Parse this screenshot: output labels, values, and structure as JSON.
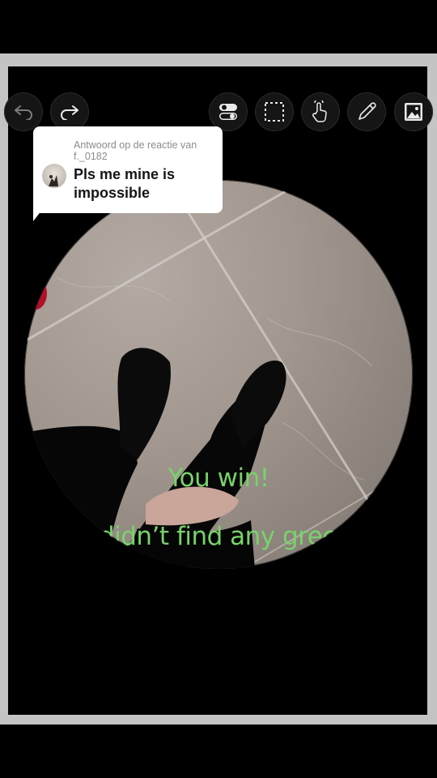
{
  "editor": {
    "toolbar": {
      "undo_icon": "undo-icon",
      "redo_icon": "redo-icon",
      "toggle_icon": "toggle-icon",
      "select_icon": "selection-box-icon",
      "gesture_icon": "hand-tap-icon",
      "pen_icon": "pencil-icon",
      "image_icon": "image-icon"
    },
    "reply": {
      "header": "Antwoord op de reactie van f._0182",
      "comment": "Pls me mine is impossible"
    },
    "overlay": {
      "line1": "You win!",
      "line2": "I didn’t find any green"
    },
    "colors": {
      "overlay_text": "#78d36a",
      "frame": "#c4c4c4",
      "background": "#000000"
    }
  }
}
